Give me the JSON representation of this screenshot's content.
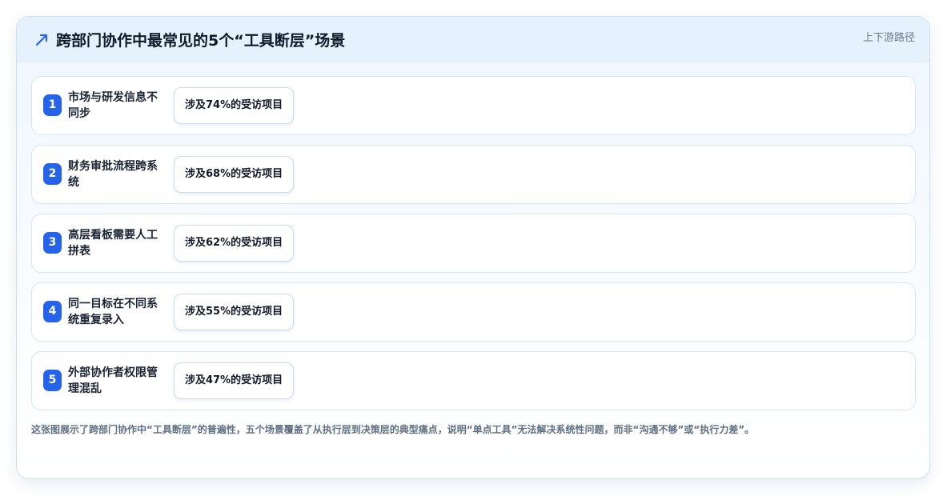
{
  "header": {
    "title": "跨部门协作中最常见的5个“工具断层”场景",
    "tag": "上下游路径",
    "icon": "trend-arrow-icon",
    "accent": "#2563eb"
  },
  "chart_data": {
    "type": "table",
    "title": "跨部门协作中最常见的5个“工具断层”场景",
    "value_unit": "%",
    "rows": [
      {
        "rank": "1",
        "scenario": "市场与研发信息不同步",
        "share": 74,
        "share_text": "涉及74%的受访项目"
      },
      {
        "rank": "2",
        "scenario": "财务审批流程跨系统",
        "share": 68,
        "share_text": "涉及68%的受访项目"
      },
      {
        "rank": "3",
        "scenario": "高层看板需要人工拼表",
        "share": 62,
        "share_text": "涉及62%的受访项目"
      },
      {
        "rank": "4",
        "scenario": "同一目标在不同系统重复录入",
        "share": 55,
        "share_text": "涉及55%的受访项目"
      },
      {
        "rank": "5",
        "scenario": "外部协作者权限管理混乱",
        "share": 47,
        "share_text": "涉及47%的受访项目"
      }
    ]
  },
  "footer": {
    "note": "这张图展示了跨部门协作中“工具断层”的普遍性，五个场景覆盖了从执行层到决策层的典型痛点，说明“单点工具”无法解决系统性问题，而非“沟通不够”或“执行力差”。"
  }
}
